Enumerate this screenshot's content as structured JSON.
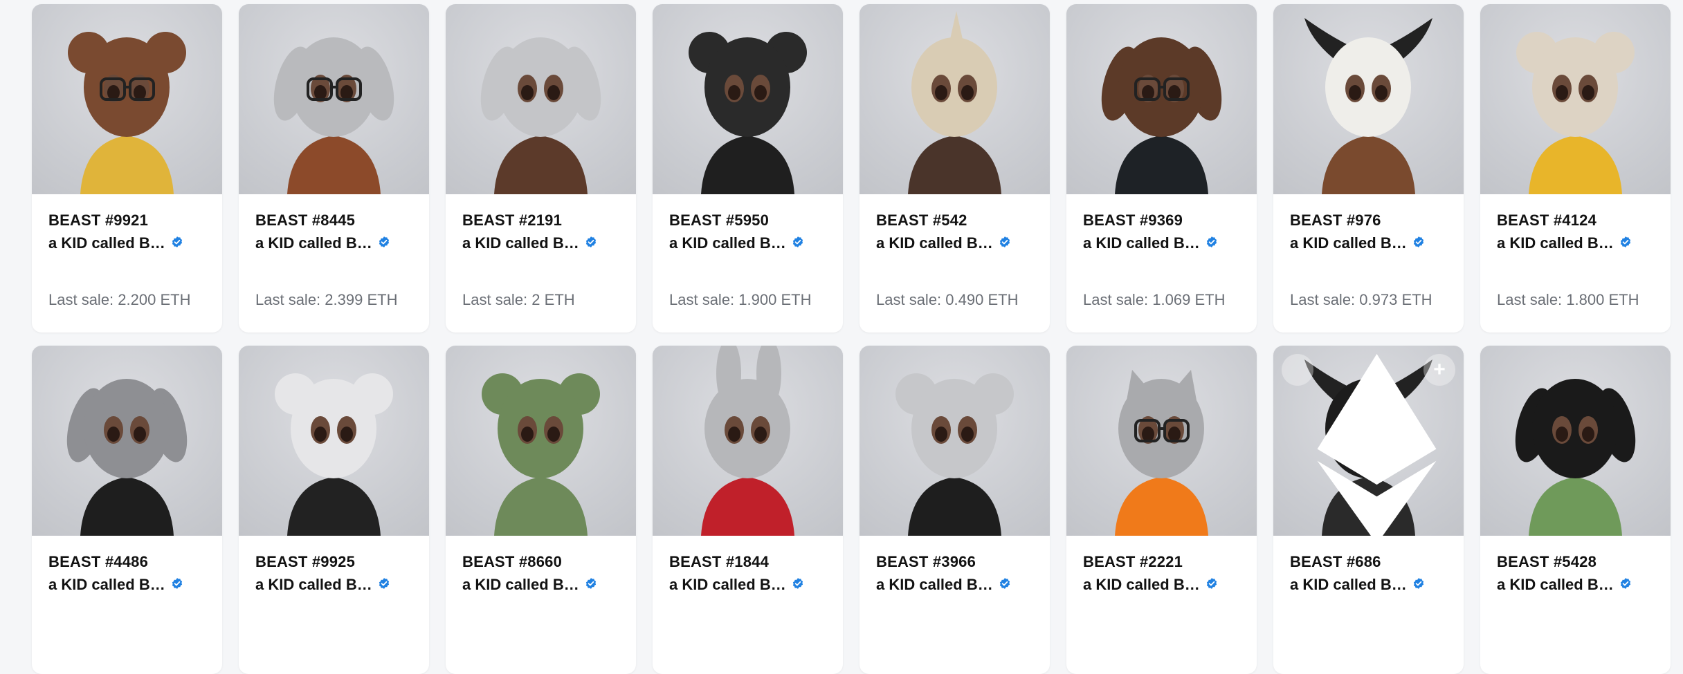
{
  "collection_name": "a KID called B…",
  "sale_prefix": "Last sale:",
  "colors": {
    "accent_verified": "#2081e2",
    "text": "#121212",
    "muted": "#6b6f76"
  },
  "cards": [
    {
      "title": "BEAST #9921",
      "last_sale": "2.200 ETH",
      "figure": {
        "head": "#7a4a30",
        "body": "#e0b43a",
        "ears": "round",
        "glasses": true
      }
    },
    {
      "title": "BEAST #8445",
      "last_sale": "2.399 ETH",
      "figure": {
        "head": "#b9babd",
        "body": "#8c4a2a",
        "ears": "floppy",
        "glasses": true
      }
    },
    {
      "title": "BEAST #2191",
      "last_sale": "2 ETH",
      "figure": {
        "head": "#c4c5c8",
        "body": "#5c3a2a",
        "ears": "floppy",
        "glasses": false
      }
    },
    {
      "title": "BEAST #5950",
      "last_sale": "1.900 ETH",
      "figure": {
        "head": "#2a2a2a",
        "body": "#1f1f1f",
        "ears": "round",
        "glasses": false
      }
    },
    {
      "title": "BEAST #542",
      "last_sale": "0.490 ETH",
      "figure": {
        "head": "#d9ccb4",
        "body": "#4a342a",
        "ears": "horn",
        "glasses": false
      }
    },
    {
      "title": "BEAST #9369",
      "last_sale": "1.069 ETH",
      "figure": {
        "head": "#5c3a28",
        "body": "#1e2226",
        "ears": "floppy",
        "glasses": true
      }
    },
    {
      "title": "BEAST #976",
      "last_sale": "0.973 ETH",
      "figure": {
        "head": "#efeeea",
        "body": "#7a4a2e",
        "ears": "horns",
        "glasses": false
      }
    },
    {
      "title": "BEAST #4124",
      "last_sale": "1.800 ETH",
      "figure": {
        "head": "#ddd3c4",
        "body": "#e8b52a",
        "ears": "round",
        "glasses": false
      }
    },
    {
      "title": "BEAST #4486",
      "last_sale": "",
      "figure": {
        "head": "#8e8f93",
        "body": "#1e1e1e",
        "ears": "floppy",
        "glasses": false
      }
    },
    {
      "title": "BEAST #9925",
      "last_sale": "",
      "figure": {
        "head": "#e6e6e8",
        "body": "#222222",
        "ears": "round",
        "glasses": false
      }
    },
    {
      "title": "BEAST #8660",
      "last_sale": "",
      "figure": {
        "head": "#6e8a5a",
        "body": "#6e8a5a",
        "ears": "round",
        "glasses": false
      }
    },
    {
      "title": "BEAST #1844",
      "last_sale": "",
      "figure": {
        "head": "#b6b7ba",
        "body": "#c0202a",
        "ears": "bunny",
        "glasses": false
      }
    },
    {
      "title": "BEAST #3966",
      "last_sale": "",
      "figure": {
        "head": "#c6c7ca",
        "body": "#1e1e1e",
        "ears": "round",
        "glasses": false
      }
    },
    {
      "title": "BEAST #2221",
      "last_sale": "",
      "figure": {
        "head": "#a9aaad",
        "body": "#f07a1a",
        "ears": "cat",
        "glasses": true
      }
    },
    {
      "title": "BEAST #686",
      "last_sale": "",
      "figure": {
        "head": "#1c1c1c",
        "body": "#2a2a2a",
        "ears": "horns",
        "glasses": false
      },
      "overlay_buttons": true
    },
    {
      "title": "BEAST #5428",
      "last_sale": "",
      "figure": {
        "head": "#1a1a1a",
        "body": "#6f9a5a",
        "ears": "floppy",
        "glasses": false
      }
    }
  ]
}
